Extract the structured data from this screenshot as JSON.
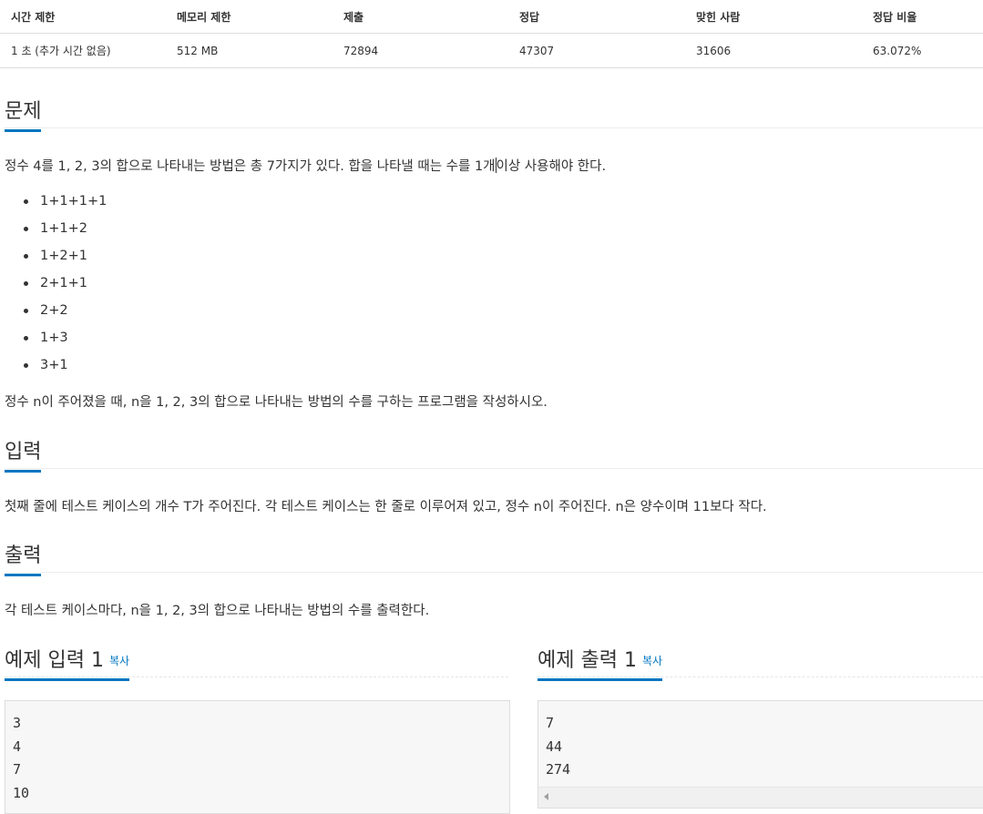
{
  "info": {
    "headers": [
      "시간 제한",
      "메모리 제한",
      "제출",
      "정답",
      "맞힌 사람",
      "정답 비율"
    ],
    "values": [
      "1 초 (추가 시간 없음)",
      "512 MB",
      "72894",
      "47307",
      "31606",
      "63.072%"
    ]
  },
  "problem": {
    "title": "문제",
    "intro_before_cursor": "정수 4를 1, 2, 3의 합으로 나타내는 방법은 총 7가지가 있다. 합을 나타낼 때는 수를 1개",
    "intro_after_cursor": "이상 사용해야 한다.",
    "items": [
      "1+1+1+1",
      "1+1+2",
      "1+2+1",
      "2+1+1",
      "2+2",
      "1+3",
      "3+1"
    ],
    "outro": "정수 n이 주어졌을 때, n을 1, 2, 3의 합으로 나타내는 방법의 수를 구하는 프로그램을 작성하시오."
  },
  "input": {
    "title": "입력",
    "text": "첫째 줄에 테스트 케이스의 개수 T가 주어진다. 각 테스트 케이스는 한 줄로 이루어져 있고, 정수 n이 주어진다. n은 양수이며 11보다 작다."
  },
  "output": {
    "title": "출력",
    "text": "각 테스트 케이스마다, n을 1, 2, 3의 합으로 나타내는 방법의 수를 출력한다."
  },
  "sample_input": {
    "title": "예제 입력 1",
    "copy_label": "복사",
    "lines": [
      "3",
      "4",
      "7",
      "10"
    ]
  },
  "sample_output": {
    "title": "예제 출력 1",
    "copy_label": "복사",
    "lines": [
      "7",
      "44",
      "274"
    ]
  },
  "colors": {
    "accent": "#0076c0",
    "text": "#333333",
    "pre_bg": "#f7f7f7"
  }
}
